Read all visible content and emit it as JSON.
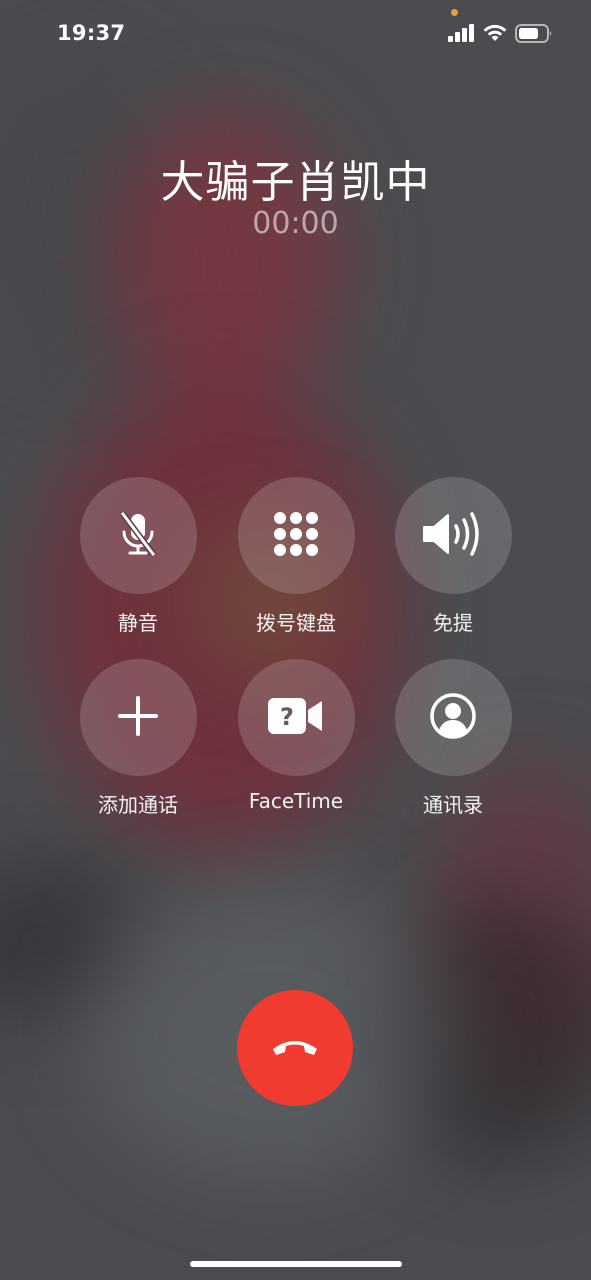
{
  "status_bar": {
    "time": "19:37",
    "icons": [
      "signal-bars-icon",
      "wifi-icon",
      "battery-icon"
    ],
    "privacy_dot_color": "#f19a36"
  },
  "call": {
    "caller_name": "大骗子肖凯中",
    "duration": "00:00"
  },
  "controls": [
    {
      "label": "静音",
      "icon": "microphone-muted-icon"
    },
    {
      "label": "拨号键盘",
      "icon": "keypad-icon"
    },
    {
      "label": "免提",
      "icon": "speaker-icon"
    },
    {
      "label": "添加通话",
      "icon": "plus-icon"
    },
    {
      "label": "FaceTime",
      "icon": "facetime-video-icon"
    },
    {
      "label": "通讯录",
      "icon": "contact-icon"
    }
  ],
  "end_call": {
    "icon": "phone-hangup-icon",
    "color": "#f23b30"
  }
}
